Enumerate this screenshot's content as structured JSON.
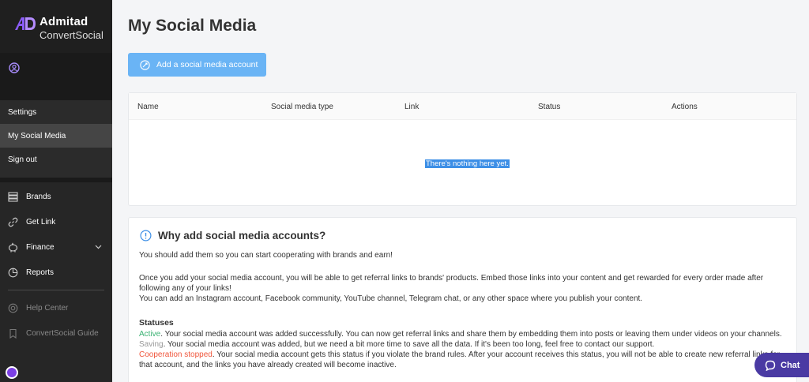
{
  "brand": {
    "title": "Admitad",
    "subtitle": "ConvertSocial"
  },
  "user_menu": [
    {
      "label": "Settings"
    },
    {
      "label": "My Social Media"
    },
    {
      "label": "Sign out"
    }
  ],
  "nav": [
    {
      "label": "Brands",
      "icon": "stack-icon"
    },
    {
      "label": "Get Link",
      "icon": "link-icon"
    },
    {
      "label": "Finance",
      "icon": "piggy-bank-icon"
    },
    {
      "label": "Reports",
      "icon": "pie-chart-icon"
    }
  ],
  "help": [
    {
      "label": "Help Center",
      "icon": "help-icon"
    },
    {
      "label": "ConvertSocial Guide",
      "icon": "bookmark-icon"
    }
  ],
  "page": {
    "title": "My Social Media",
    "add_button": "Add a social media account"
  },
  "table": {
    "columns": [
      "Name",
      "Social media type",
      "Link",
      "Status",
      "Actions"
    ],
    "empty_text": "There's nothing here yet."
  },
  "info": {
    "title": "Why add social media accounts?",
    "p1": "You should add them so you can start cooperating with brands and earn!",
    "p2": "Once you add your social media account, you will be able to get referral links to brands' products. Embed those links into your content and get rewarded for every order made after following any of your links!",
    "p3": "You can add an Instagram account, Facebook community, YouTube channel, Telegram chat, or any other space where you publish your content.",
    "statuses_title": "Statuses",
    "active_label": "Active",
    "active_text": ". Your social media account was added successfully. You can now get referral links and share them by embedding them into posts or leaving them under videos on your channels.",
    "saving_label": "Saving",
    "saving_text": ". Your social media account was added, but we need a bit more time to save all the data. If it's been too long, feel free to contact our support.",
    "stopped_label": "Cooperation stopped",
    "stopped_text": ". Your social media account gets this status if you violate the brand rules. After your account receives this status, you will not be able to create new referral links for that account, and the links you have already created will become inactive."
  },
  "chat": {
    "label": "Chat"
  },
  "colors": {
    "accent": "#6ab4f5",
    "sidebar": "#262626",
    "chat": "#4a3aa3",
    "active": "#3bb273",
    "stopped": "#f0563c"
  }
}
